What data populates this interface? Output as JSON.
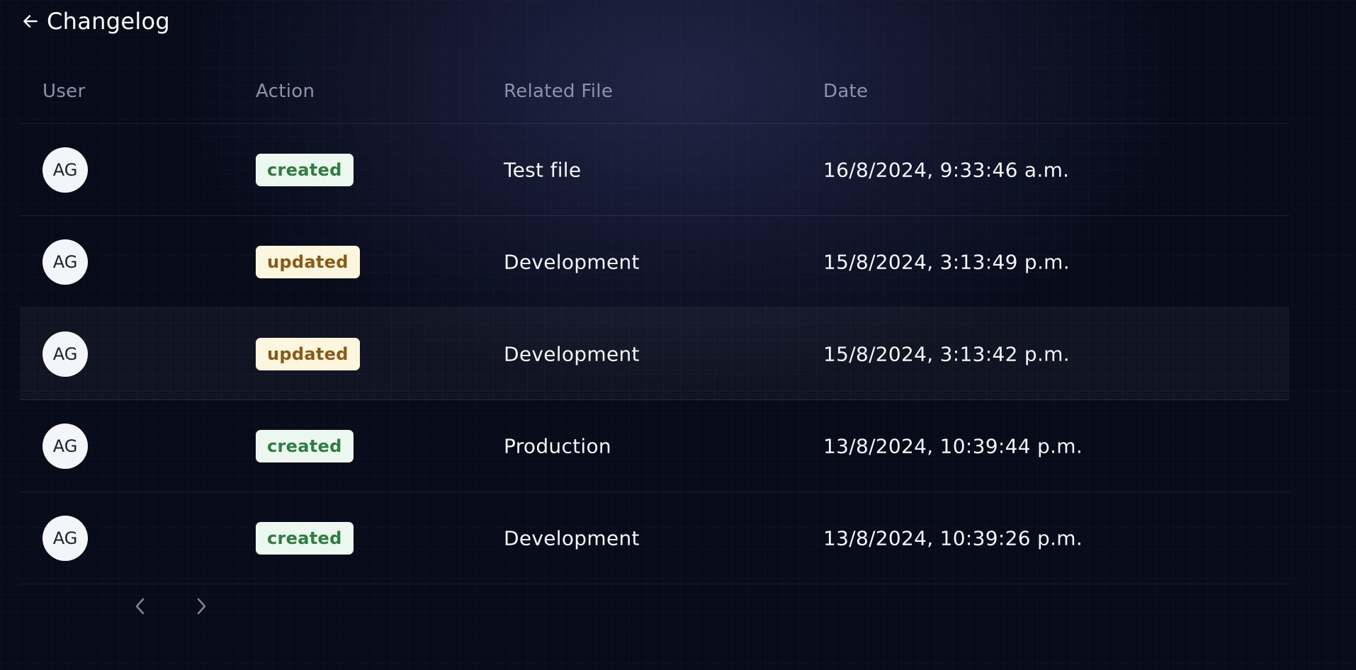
{
  "header": {
    "back_icon": "arrow-left-icon",
    "title": "Changelog"
  },
  "table": {
    "columns": {
      "user": "User",
      "action": "Action",
      "file": "Related File",
      "date": "Date"
    },
    "rows": [
      {
        "initials": "AG",
        "action": "created",
        "file": "Test file",
        "date": "16/8/2024, 9:33:46 a.m."
      },
      {
        "initials": "AG",
        "action": "updated",
        "file": "Development",
        "date": "15/8/2024, 3:13:49 p.m."
      },
      {
        "initials": "AG",
        "action": "updated",
        "file": "Development",
        "date": "15/8/2024, 3:13:42 p.m."
      },
      {
        "initials": "AG",
        "action": "created",
        "file": "Production",
        "date": "13/8/2024, 10:39:44 p.m."
      },
      {
        "initials": "AG",
        "action": "created",
        "file": "Development",
        "date": "13/8/2024, 10:39:26 p.m."
      }
    ]
  },
  "pagination": {
    "prev_icon": "chevron-left-icon",
    "next_icon": "chevron-right-icon"
  },
  "colors": {
    "background": "#070b1a",
    "created_bg": "#ecf8ef",
    "created_text": "#2e7d43",
    "updated_bg": "#fdf6df",
    "updated_text": "#8a5a17"
  }
}
